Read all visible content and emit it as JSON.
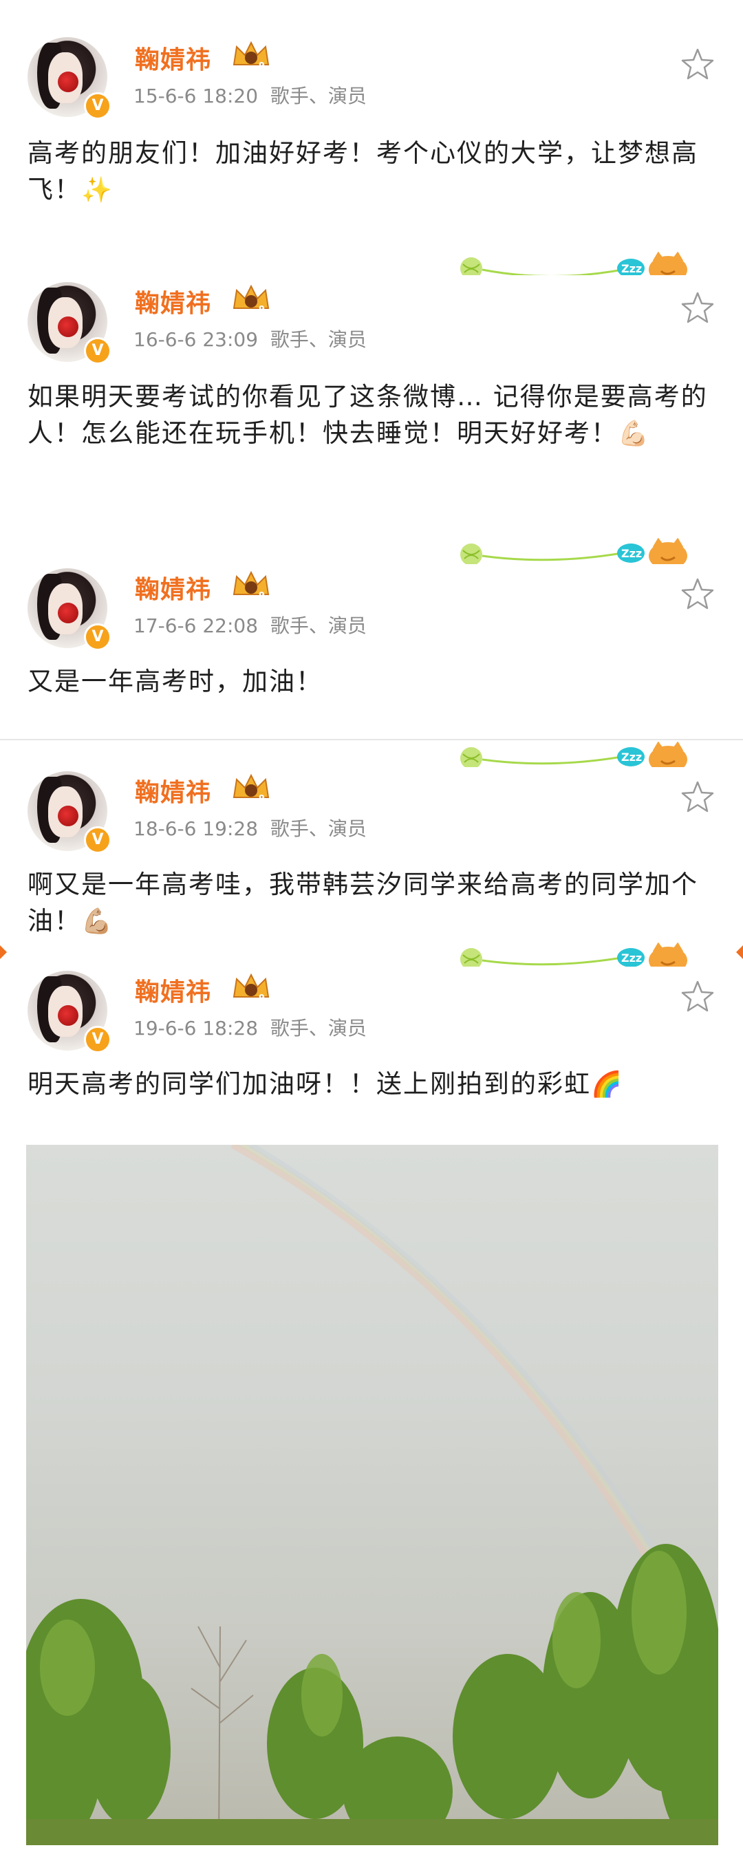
{
  "user": {
    "name": "鞠婧祎",
    "tags": "歌手、演员"
  },
  "posts": [
    {
      "time": "15-6-6 18:20",
      "text": "高考的朋友们！加油好好考！考个心仪的大学，让梦想高飞！",
      "emoji": "✨"
    },
    {
      "time": "16-6-6 23:09",
      "text": "如果明天要考试的你看见了这条微博… 记得你是要高考的人！怎么能还在玩手机！快去睡觉！明天好好考！",
      "emoji": "💪🏻"
    },
    {
      "time": "17-6-6 22:08",
      "text": "又是一年高考时，加油！",
      "emoji": ""
    },
    {
      "time": "18-6-6 19:28",
      "text": "啊又是一年高考哇，我带韩芸汐同学来给高考的同学加个油！",
      "emoji": "💪🏼"
    },
    {
      "time": "19-6-6 18:28",
      "text": "明天高考的同学们加油呀！！送上刚拍到的彩虹",
      "emoji": "🌈"
    }
  ],
  "icons": {
    "verified": "verified-badge-icon",
    "crown": "crown-level-icon",
    "star": "star-favorite-icon",
    "deco": "yarn-cat-sleeping-decoration"
  },
  "badge": {
    "verified_letter": "V",
    "level": "9"
  },
  "colors": {
    "username": "#f07020",
    "meta": "#8a8a8a",
    "badge": "#f7a21b",
    "deco_line": "#a6d94a",
    "zzz": "#29c4d6",
    "cat": "#f5a43a"
  }
}
